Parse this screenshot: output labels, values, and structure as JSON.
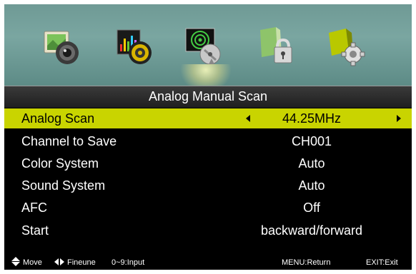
{
  "icons": [
    {
      "name": "picture-icon",
      "selected": false
    },
    {
      "name": "sound-icon",
      "selected": false
    },
    {
      "name": "channel-icon",
      "selected": true
    },
    {
      "name": "lock-icon",
      "selected": false
    },
    {
      "name": "setup-icon",
      "selected": false
    }
  ],
  "title": "Analog Manual Scan",
  "menu": [
    {
      "label": "Analog Scan",
      "value": "44.25MHz",
      "selected": true
    },
    {
      "label": "Channel to Save",
      "value": "CH001",
      "selected": false
    },
    {
      "label": "Color System",
      "value": "Auto",
      "selected": false
    },
    {
      "label": "Sound System",
      "value": "Auto",
      "selected": false
    },
    {
      "label": "AFC",
      "value": "Off",
      "selected": false
    },
    {
      "label": "Start",
      "value": "backward/forward",
      "selected": false
    }
  ],
  "footer": {
    "move": "Move",
    "fineune": "Fineune",
    "input": "0~9:Input",
    "return": "MENU:Return",
    "exit": "EXIT:Exit"
  },
  "colors": {
    "highlight": "#c9d400",
    "icon_bar": "#6f9a95",
    "background": "#000000"
  }
}
